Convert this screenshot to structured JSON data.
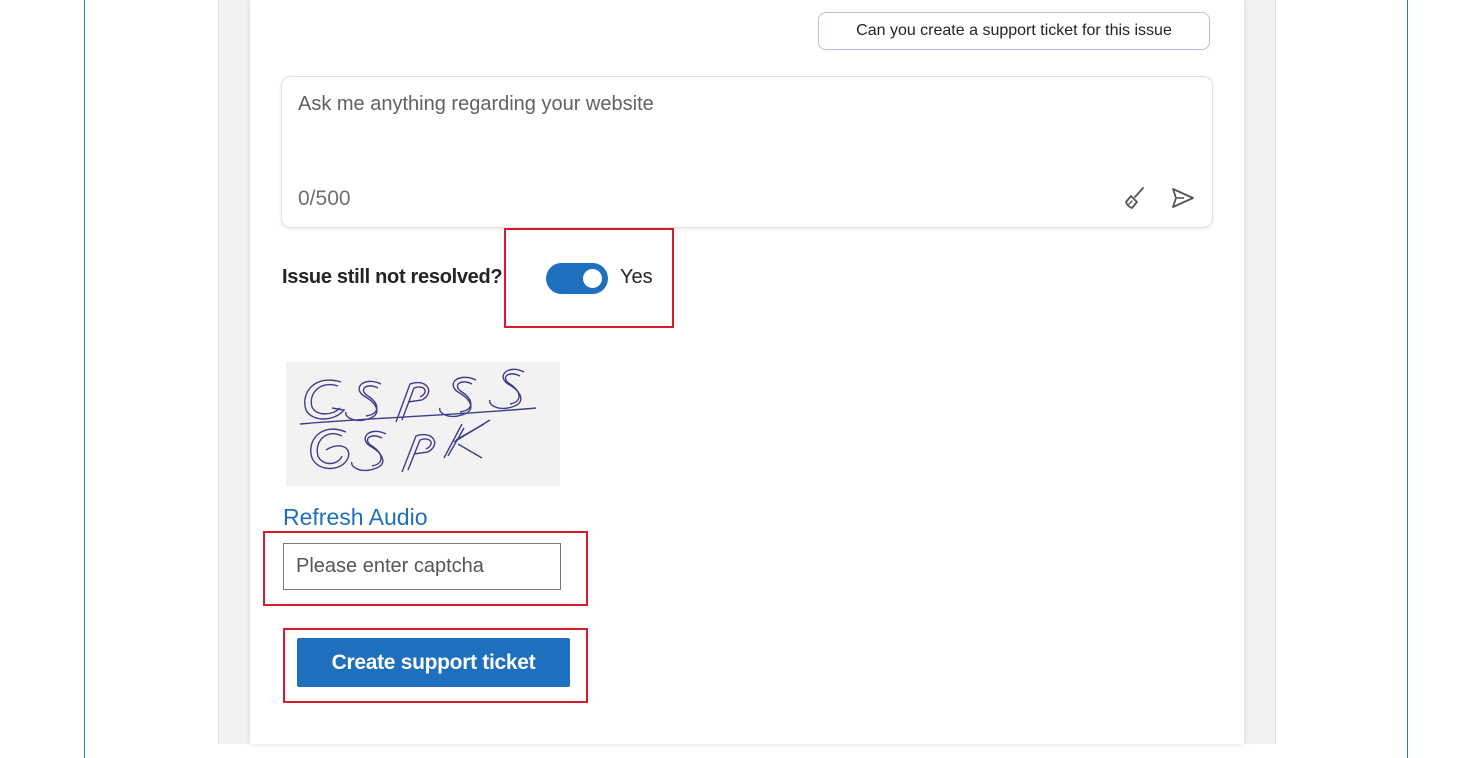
{
  "chat": {
    "suggestion_chip": "Can you create a support ticket for this issue",
    "input_placeholder": "Ask me anything regarding your website",
    "char_count": "0/500",
    "clear_icon": "broom-icon",
    "send_icon": "send-icon"
  },
  "resolution": {
    "label": "Issue still not resolved?",
    "toggle_on": true,
    "toggle_value": "Yes"
  },
  "captcha": {
    "image_text": "GSpS 6SPK",
    "refresh_link": "Refresh Audio",
    "input_placeholder": "Please enter captcha"
  },
  "actions": {
    "submit_label": "Create support ticket"
  },
  "colors": {
    "accent": "#1f6fbf",
    "highlight": "#d91c2b",
    "chip_border": "#b9bdf0",
    "captcha_ink": "#3d3f8a"
  }
}
